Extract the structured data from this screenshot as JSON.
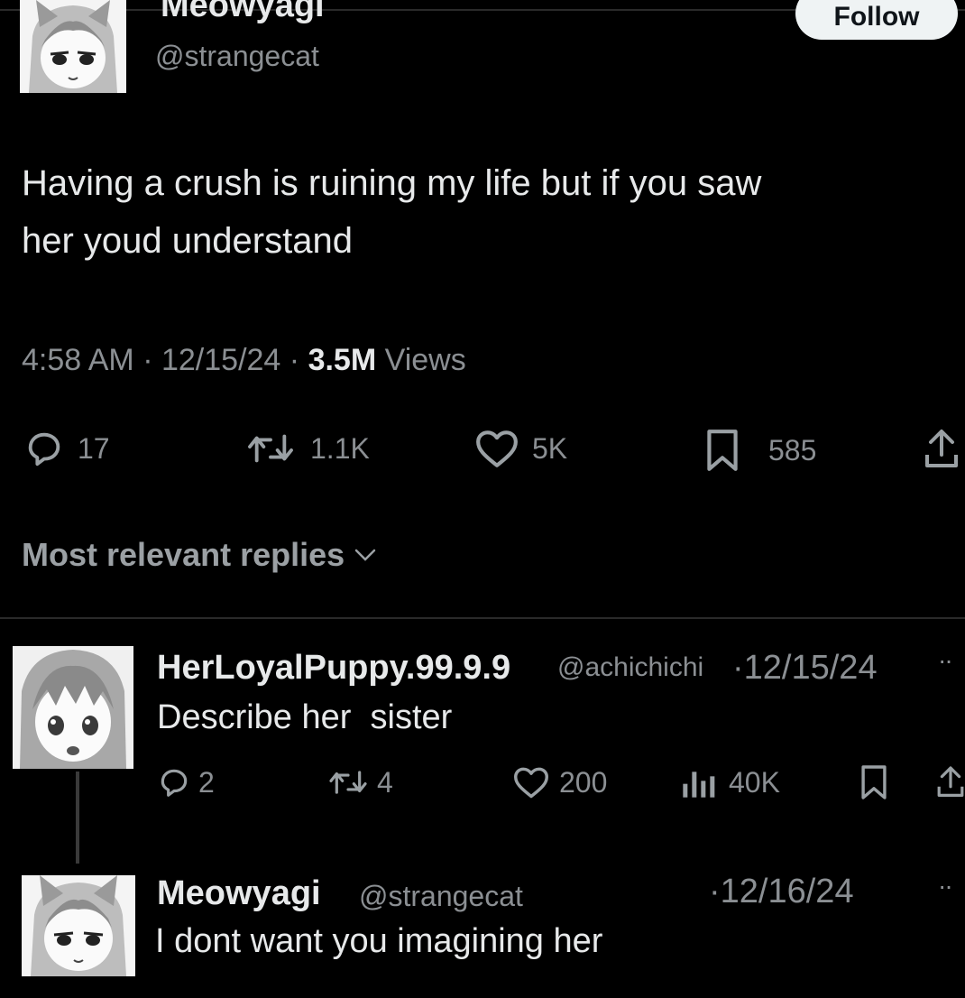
{
  "post": {
    "author": {
      "name": "Meowyagi",
      "handle": "@strangecat"
    },
    "follow_label": "Follow",
    "text_line1": "Having a crush is ruining my life but if you saw",
    "text_line2": "her youd understand",
    "time": "4:58 AM",
    "sep1": "·",
    "date": "12/15/24",
    "sep2": "·",
    "views_count": "3.5M",
    "views_label": "Views",
    "actions": {
      "replies": "17",
      "reposts": "1.1K",
      "likes": "5K",
      "bookmarks": "585"
    }
  },
  "sort": {
    "label": "Most relevant replies"
  },
  "replies": [
    {
      "name": "HerLoyalPuppy.99.9.9",
      "handle": "@achichichi",
      "sep": "·",
      "date": "12/15/24",
      "text": "Describe her  sister",
      "actions": {
        "replies": "2",
        "reposts": "4",
        "likes": "200",
        "views": "40K"
      }
    },
    {
      "name": "Meowyagi",
      "handle": "@strangecat",
      "sep": "·",
      "date": "12/16/24",
      "text": "I dont want you imagining her"
    }
  ],
  "icons": {
    "reply": "speech-bubble-icon",
    "repost": "repost-arrows-icon",
    "like": "heart-icon",
    "bookmark": "bookmark-icon",
    "share": "share-upload-icon",
    "views": "bar-chart-icon",
    "more": "more-dots-icon",
    "chevron": "chevron-down-icon"
  },
  "colors": {
    "background": "#000000",
    "text": "#e7e9ea",
    "muted": "#8b8f93",
    "button": "#eff3f4"
  }
}
